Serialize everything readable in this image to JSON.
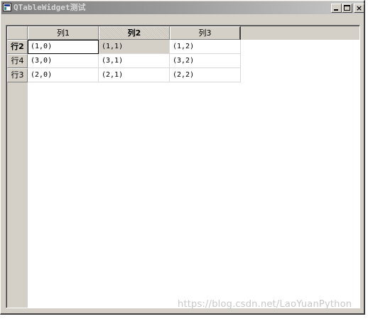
{
  "window": {
    "title": "QTableWidget测试",
    "minimize_symbol": "_",
    "maximize_symbol": "□",
    "close_symbol": "×"
  },
  "table": {
    "columns": [
      "列1",
      "列2",
      "列3"
    ],
    "rows": [
      {
        "header": "行2",
        "cells": [
          "(1,0)",
          "(1,1)",
          "(1,2)"
        ]
      },
      {
        "header": "行4",
        "cells": [
          "(3,0)",
          "(3,1)",
          "(3,2)"
        ]
      },
      {
        "header": "行3",
        "cells": [
          "(2,0)",
          "(2,1)",
          "(2,2)"
        ]
      }
    ],
    "current_row": "行2",
    "current_column": "列2"
  },
  "watermark": "https://blog.csdn.net/LaoYuanPython",
  "icons": {
    "app": "qt-app-icon"
  }
}
